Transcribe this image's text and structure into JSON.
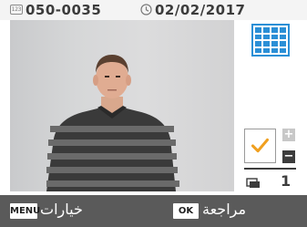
{
  "header": {
    "folder_icon_text": "123",
    "folder_number": "050-0035",
    "date": "02/02/2017",
    "icons": [
      "folder-icon",
      "clock-icon"
    ]
  },
  "preview": {
    "description_icon": "photo-preview"
  },
  "side_panel": {
    "grid_icon": "grid-view-icon",
    "check_icon": "checkmark-icon",
    "plus_label": "+",
    "minus_label": "−",
    "copies_icon": "copies-icon",
    "copies_count": "1"
  },
  "footer": {
    "menu_key": "MENU",
    "menu_label": "خيارات",
    "ok_key": "OK",
    "ok_label": "مراجعة"
  },
  "colors": {
    "accent_blue": "#2b8fd6",
    "check_orange": "#f0a020",
    "footer_bg": "#5a5a5a"
  }
}
